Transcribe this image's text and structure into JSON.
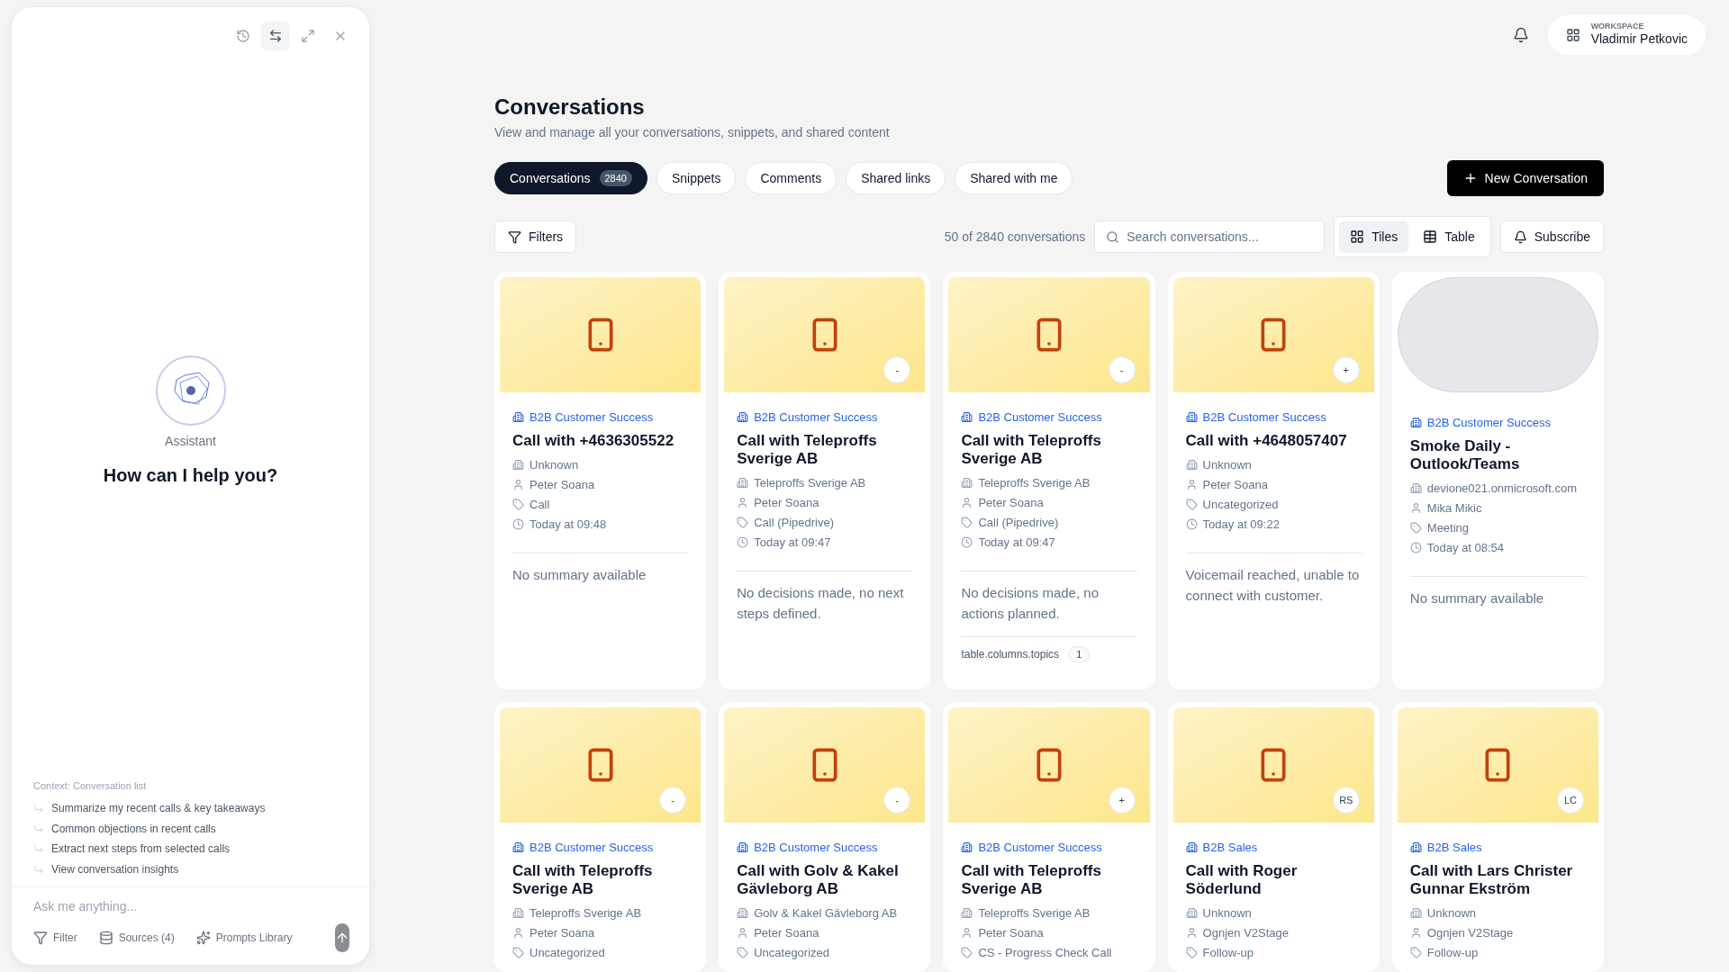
{
  "assistant": {
    "name": "Assistant",
    "heading": "How can I help you?",
    "context": "Context: Conversation list",
    "suggestions": [
      "Summarize my recent calls & key takeaways",
      "Common objections in recent calls",
      "Extract next steps from selected calls",
      "View conversation insights"
    ],
    "input": {
      "placeholder": "Ask me anything..."
    },
    "tools": [
      {
        "kind": "filter",
        "label": "Filter"
      },
      {
        "kind": "sources",
        "label": "Sources (4)"
      },
      {
        "kind": "prompts",
        "label": "Prompts Library"
      }
    ]
  },
  "topbar": {
    "workspace_label": "WORKSPACE",
    "workspace_name": "Vladimir Petkovic"
  },
  "page": {
    "title": "Conversations",
    "subtitle": "View and manage all your conversations, snippets, and shared content"
  },
  "tabs": [
    {
      "label": "Conversations",
      "count": "2840",
      "selected": true
    },
    {
      "label": "Snippets",
      "selected": false
    },
    {
      "label": "Comments",
      "selected": false
    },
    {
      "label": "Shared links",
      "selected": false
    },
    {
      "label": "Shared with me",
      "selected": false
    }
  ],
  "new_button": "New Conversation",
  "toolbar": {
    "filters": "Filters",
    "result_count": "50 of 2840 conversations",
    "search": {
      "placeholder": "Search conversations..."
    },
    "views": [
      {
        "kind": "tiles",
        "label": "Tiles",
        "selected": true
      },
      {
        "kind": "table",
        "label": "Table",
        "selected": false
      }
    ],
    "subscribe": "Subscribe"
  },
  "cards": [
    {
      "kind": "call",
      "team": "B2B Customer Success",
      "title": "Call with +4636305522",
      "company": "Unknown",
      "owner": "Peter Soana",
      "category": "Call",
      "time": "Today at 09:48",
      "summary": "No summary available"
    },
    {
      "kind": "call",
      "badge": "-",
      "team": "B2B Customer Success",
      "title": "Call with Teleproffs Sverige AB",
      "company": "Teleproffs Sverige AB",
      "owner": "Peter Soana",
      "category": "Call (Pipedrive)",
      "time": "Today at 09:47",
      "summary": "No decisions made, no next steps defined."
    },
    {
      "kind": "call",
      "badge": "-",
      "team": "B2B Customer Success",
      "title": "Call with Teleproffs Sverige AB",
      "company": "Teleproffs Sverige AB",
      "owner": "Peter Soana",
      "category": "Call (Pipedrive)",
      "time": "Today at 09:47",
      "summary": "No decisions made, no actions planned.",
      "topics_label": "table.columns.topics",
      "topics_count": "1"
    },
    {
      "kind": "call",
      "badge": "+",
      "team": "B2B Customer Success",
      "title": "Call with +4648057407",
      "company": "Unknown",
      "owner": "Peter Soana",
      "category": "Uncategorized",
      "time": "Today at 09:22",
      "summary": "Voicemail reached, unable to connect with customer."
    },
    {
      "kind": "blank",
      "team": "B2B Customer Success",
      "title": "Smoke Daily - Outlook/Teams",
      "company": "devione021.onmicrosoft.com",
      "owner": "Mika Mikic",
      "category": "Meeting",
      "time": "Today at 08:54",
      "summary": "No summary available"
    },
    {
      "kind": "call",
      "badge": "-",
      "team": "B2B Customer Success",
      "title": "Call with Teleproffs Sverige AB",
      "company": "Teleproffs Sverige AB",
      "owner": "Peter Soana",
      "category": "Uncategorized"
    },
    {
      "kind": "call",
      "badge": "-",
      "team": "B2B Customer Success",
      "title": "Call with Golv & Kakel Gävleborg AB",
      "company": "Golv & Kakel Gävleborg AB",
      "owner": "Peter Soana",
      "category": "Uncategorized"
    },
    {
      "kind": "call",
      "badge": "+",
      "team": "B2B Customer Success",
      "title": "Call with Teleproffs Sverige AB",
      "company": "Teleproffs Sverige AB",
      "owner": "Peter Soana",
      "category": "CS - Progress Check Call"
    },
    {
      "kind": "call",
      "badge": "RS",
      "team": "B2B Sales",
      "title": "Call with Roger Söderlund",
      "company": "Unknown",
      "owner": "Ognjen V2Stage",
      "category": "Follow-up"
    },
    {
      "kind": "call",
      "badge": "LC",
      "team": "B2B Sales",
      "title": "Call with Lars Christer Gunnar Ekström",
      "company": "Unknown",
      "owner": "Ognjen V2Stage",
      "category": "Follow-up"
    }
  ]
}
